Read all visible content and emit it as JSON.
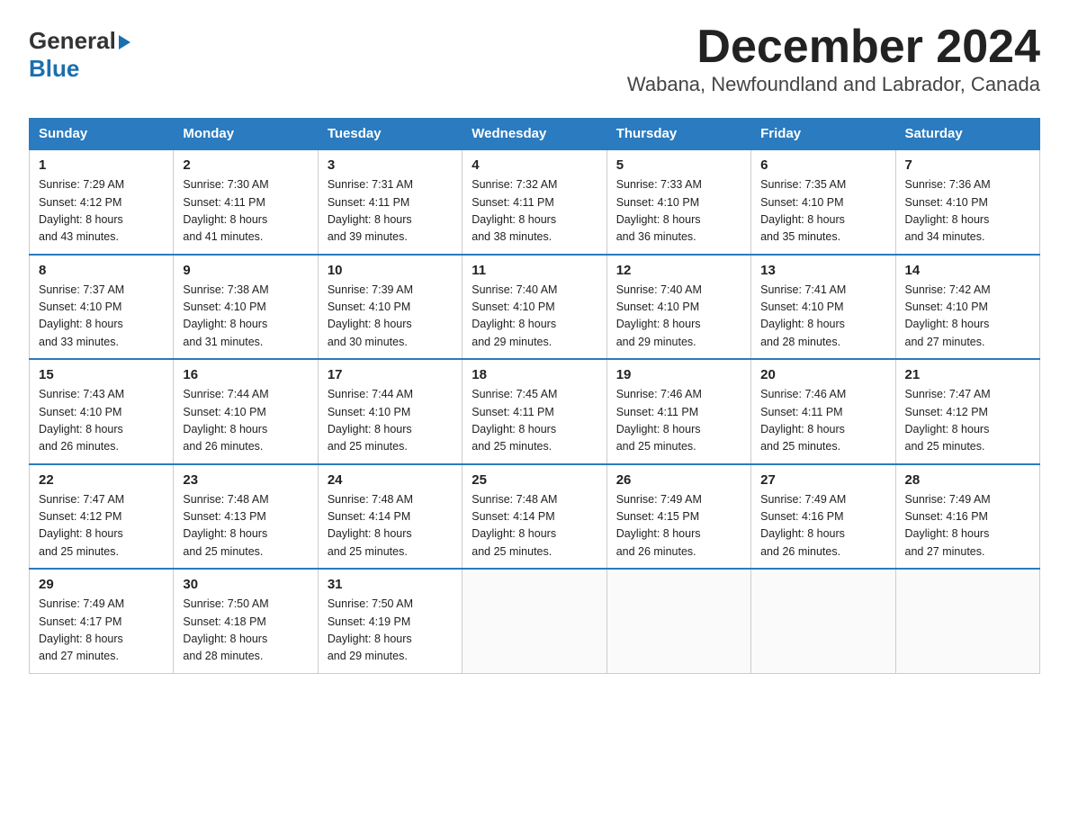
{
  "header": {
    "logo_general": "General",
    "logo_blue": "Blue",
    "month_title": "December 2024",
    "location": "Wabana, Newfoundland and Labrador, Canada"
  },
  "days_of_week": [
    "Sunday",
    "Monday",
    "Tuesday",
    "Wednesday",
    "Thursday",
    "Friday",
    "Saturday"
  ],
  "weeks": [
    [
      {
        "day": "1",
        "sunrise": "7:29 AM",
        "sunset": "4:12 PM",
        "daylight": "8 hours and 43 minutes."
      },
      {
        "day": "2",
        "sunrise": "7:30 AM",
        "sunset": "4:11 PM",
        "daylight": "8 hours and 41 minutes."
      },
      {
        "day": "3",
        "sunrise": "7:31 AM",
        "sunset": "4:11 PM",
        "daylight": "8 hours and 39 minutes."
      },
      {
        "day": "4",
        "sunrise": "7:32 AM",
        "sunset": "4:11 PM",
        "daylight": "8 hours and 38 minutes."
      },
      {
        "day": "5",
        "sunrise": "7:33 AM",
        "sunset": "4:10 PM",
        "daylight": "8 hours and 36 minutes."
      },
      {
        "day": "6",
        "sunrise": "7:35 AM",
        "sunset": "4:10 PM",
        "daylight": "8 hours and 35 minutes."
      },
      {
        "day": "7",
        "sunrise": "7:36 AM",
        "sunset": "4:10 PM",
        "daylight": "8 hours and 34 minutes."
      }
    ],
    [
      {
        "day": "8",
        "sunrise": "7:37 AM",
        "sunset": "4:10 PM",
        "daylight": "8 hours and 33 minutes."
      },
      {
        "day": "9",
        "sunrise": "7:38 AM",
        "sunset": "4:10 PM",
        "daylight": "8 hours and 31 minutes."
      },
      {
        "day": "10",
        "sunrise": "7:39 AM",
        "sunset": "4:10 PM",
        "daylight": "8 hours and 30 minutes."
      },
      {
        "day": "11",
        "sunrise": "7:40 AM",
        "sunset": "4:10 PM",
        "daylight": "8 hours and 29 minutes."
      },
      {
        "day": "12",
        "sunrise": "7:40 AM",
        "sunset": "4:10 PM",
        "daylight": "8 hours and 29 minutes."
      },
      {
        "day": "13",
        "sunrise": "7:41 AM",
        "sunset": "4:10 PM",
        "daylight": "8 hours and 28 minutes."
      },
      {
        "day": "14",
        "sunrise": "7:42 AM",
        "sunset": "4:10 PM",
        "daylight": "8 hours and 27 minutes."
      }
    ],
    [
      {
        "day": "15",
        "sunrise": "7:43 AM",
        "sunset": "4:10 PM",
        "daylight": "8 hours and 26 minutes."
      },
      {
        "day": "16",
        "sunrise": "7:44 AM",
        "sunset": "4:10 PM",
        "daylight": "8 hours and 26 minutes."
      },
      {
        "day": "17",
        "sunrise": "7:44 AM",
        "sunset": "4:10 PM",
        "daylight": "8 hours and 25 minutes."
      },
      {
        "day": "18",
        "sunrise": "7:45 AM",
        "sunset": "4:11 PM",
        "daylight": "8 hours and 25 minutes."
      },
      {
        "day": "19",
        "sunrise": "7:46 AM",
        "sunset": "4:11 PM",
        "daylight": "8 hours and 25 minutes."
      },
      {
        "day": "20",
        "sunrise": "7:46 AM",
        "sunset": "4:11 PM",
        "daylight": "8 hours and 25 minutes."
      },
      {
        "day": "21",
        "sunrise": "7:47 AM",
        "sunset": "4:12 PM",
        "daylight": "8 hours and 25 minutes."
      }
    ],
    [
      {
        "day": "22",
        "sunrise": "7:47 AM",
        "sunset": "4:12 PM",
        "daylight": "8 hours and 25 minutes."
      },
      {
        "day": "23",
        "sunrise": "7:48 AM",
        "sunset": "4:13 PM",
        "daylight": "8 hours and 25 minutes."
      },
      {
        "day": "24",
        "sunrise": "7:48 AM",
        "sunset": "4:14 PM",
        "daylight": "8 hours and 25 minutes."
      },
      {
        "day": "25",
        "sunrise": "7:48 AM",
        "sunset": "4:14 PM",
        "daylight": "8 hours and 25 minutes."
      },
      {
        "day": "26",
        "sunrise": "7:49 AM",
        "sunset": "4:15 PM",
        "daylight": "8 hours and 26 minutes."
      },
      {
        "day": "27",
        "sunrise": "7:49 AM",
        "sunset": "4:16 PM",
        "daylight": "8 hours and 26 minutes."
      },
      {
        "day": "28",
        "sunrise": "7:49 AM",
        "sunset": "4:16 PM",
        "daylight": "8 hours and 27 minutes."
      }
    ],
    [
      {
        "day": "29",
        "sunrise": "7:49 AM",
        "sunset": "4:17 PM",
        "daylight": "8 hours and 27 minutes."
      },
      {
        "day": "30",
        "sunrise": "7:50 AM",
        "sunset": "4:18 PM",
        "daylight": "8 hours and 28 minutes."
      },
      {
        "day": "31",
        "sunrise": "7:50 AM",
        "sunset": "4:19 PM",
        "daylight": "8 hours and 29 minutes."
      },
      null,
      null,
      null,
      null
    ]
  ],
  "labels": {
    "sunrise": "Sunrise:",
    "sunset": "Sunset:",
    "daylight": "Daylight:"
  }
}
